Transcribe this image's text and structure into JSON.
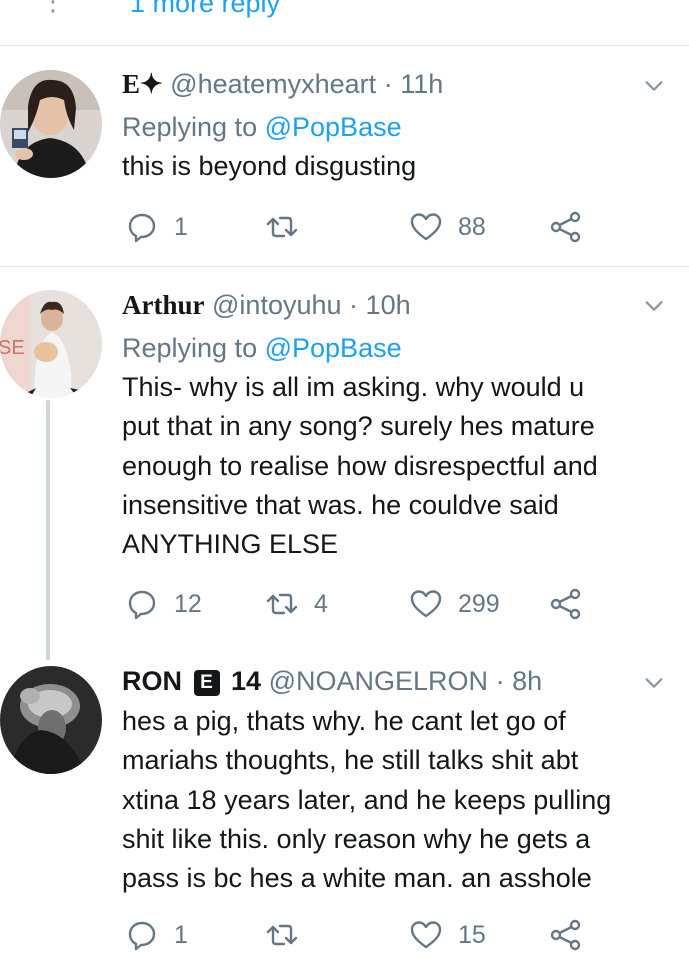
{
  "top": {
    "more_reply": "1 more reply"
  },
  "tweets": [
    {
      "name": "E✦",
      "handle": "@heatemyxheart",
      "separator": "·",
      "time": "11h",
      "replying_prefix": "Replying to",
      "replying_to": "@PopBase",
      "text": "this is beyond disgusting",
      "reply_count": "1",
      "retweet_count": "",
      "like_count": "88"
    },
    {
      "name": "Arthur",
      "handle": "@intoyuhu",
      "separator": "·",
      "time": "10h",
      "replying_prefix": "Replying to",
      "replying_to": "@PopBase",
      "text_lines": [
        "This- why is all im asking. why would u",
        "put that in any song? surely hes mature",
        "enough to realise how disrespectful and",
        "insensitive that was. he couldve said",
        "ANYTHING ELSE"
      ],
      "reply_count": "12",
      "retweet_count": "4",
      "like_count": "299"
    },
    {
      "name": "RON",
      "badge": "E",
      "name_suffix": "14",
      "handle": "@NOANGELRON",
      "separator": "·",
      "time": "8h",
      "text_lines": [
        "hes a pig, thats why. he cant let go of",
        "mariahs thoughts, he still talks shit abt",
        "xtina 18 years later, and he keeps pulling",
        "shit like this. only reason why he gets a",
        "pass is bc hes a white man. an asshole"
      ],
      "reply_count": "1",
      "retweet_count": "",
      "like_count": "15"
    }
  ],
  "icons": {
    "reply": "reply-icon",
    "retweet": "retweet-icon",
    "like": "heart-icon",
    "share": "share-icon",
    "caret": "chevron-down-icon"
  },
  "colors": {
    "accent": "#1da1f2",
    "secondary_text": "#657786",
    "primary_text": "#14171a",
    "divider": "#e1e8ed",
    "thread_line": "#ccd6dd"
  }
}
